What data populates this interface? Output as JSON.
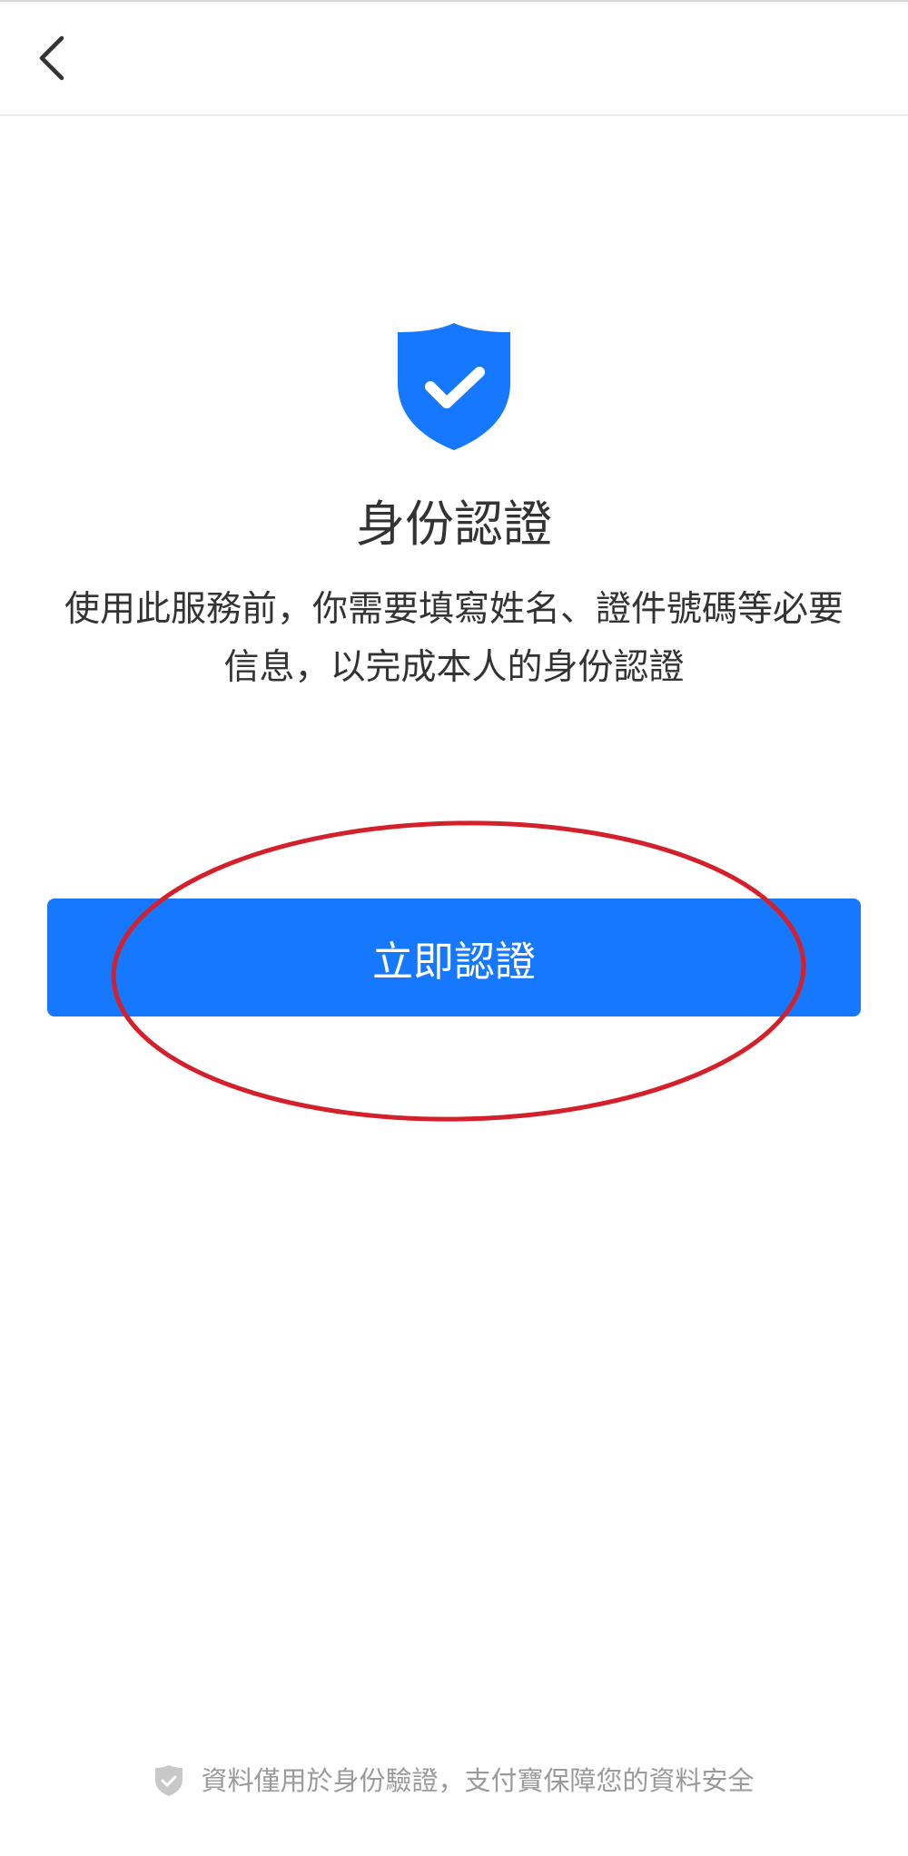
{
  "nav": {
    "back_icon": "chevron-left-icon"
  },
  "hero": {
    "icon": "shield-check-icon",
    "title": "身份認證",
    "description_line1": "使用此服務前，你需要填寫姓名、證件號碼等必要",
    "description_line2": "信息，以完成本人的身份認證"
  },
  "actions": {
    "verify_label": "立即認證"
  },
  "footer": {
    "icon": "shield-check-icon",
    "note": "資料僅用於身份驗證，支付寶保障您的資料安全"
  },
  "colors": {
    "accent": "#1677ff",
    "annotation": "#d3202a",
    "footer_text": "#9a9a9a"
  }
}
